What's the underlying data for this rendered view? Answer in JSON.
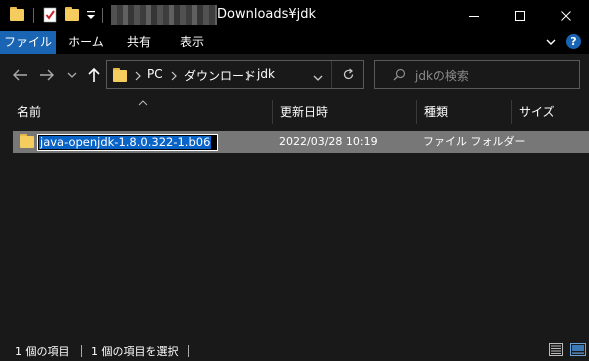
{
  "window": {
    "title_suffix": "Downloads¥jdk",
    "controls": {
      "minimize": "─",
      "maximize": "□",
      "close": "✕"
    }
  },
  "ribbon": {
    "tabs": [
      "ファイル",
      "ホーム",
      "共有",
      "表示"
    ],
    "help": "?"
  },
  "address": {
    "crumbs": [
      "PC",
      "ダウンロード",
      "jdk"
    ]
  },
  "search": {
    "placeholder": "jdkの検索"
  },
  "columns": [
    "名前",
    "更新日時",
    "種類",
    "サイズ"
  ],
  "files": [
    {
      "name": "java-openjdk-1.8.0.322-1.b06",
      "modified": "2022/03/28 10:19",
      "type": "ファイル フォルダー",
      "size": ""
    }
  ],
  "status": {
    "item_count": "1 個の項目",
    "selected": "1 個の項目を選択"
  },
  "colors": {
    "accent": "#1a64b4",
    "selection": "#777777",
    "rename_highlight": "#0a64c8",
    "folder": "#f4cd5e",
    "background": "#191919"
  },
  "icons": {
    "quick_access": [
      "folder-icon",
      "properties-check-icon",
      "new-folder-icon",
      "customize-dropdown-icon"
    ],
    "nav": [
      "back-arrow-icon",
      "forward-arrow-icon",
      "recent-dropdown-icon",
      "up-arrow-icon"
    ],
    "address": [
      "folder-icon",
      "chevron-right-icon",
      "history-dropdown-icon",
      "refresh-icon"
    ],
    "search": "search-icon",
    "status": [
      "details-view-icon",
      "large-icons-view-icon"
    ]
  }
}
